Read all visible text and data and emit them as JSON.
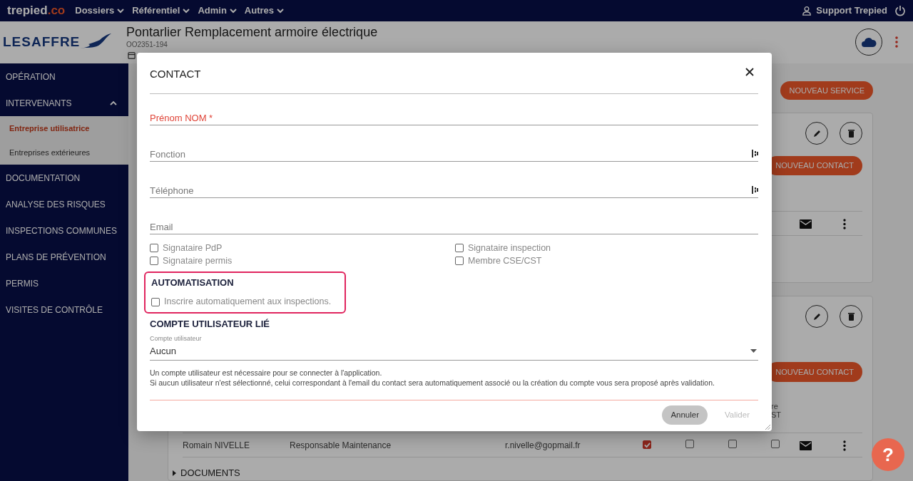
{
  "navbar": {
    "brand": {
      "name": "trepied",
      "suffix": ".co"
    },
    "menus": [
      "Dossiers",
      "Référentiel",
      "Admin",
      "Autres"
    ],
    "user": "Support Trepied"
  },
  "header": {
    "company": "LESAFFRE",
    "title": "Pontarlier Remplacement armoire électrique",
    "code": "OO2351-194"
  },
  "sidebar": {
    "items": [
      {
        "label": "OPÉRATION",
        "kind": "link"
      },
      {
        "label": "INTERVENANTS",
        "kind": "group",
        "expanded": true,
        "children": [
          {
            "label": "Entreprise utilisatrice",
            "selected": true
          },
          {
            "label": "Entreprises extérieures",
            "selected": false
          }
        ]
      },
      {
        "label": "DOCUMENTATION",
        "kind": "link"
      },
      {
        "label": "ANALYSE DES RISQUES",
        "kind": "link"
      },
      {
        "label": "INSPECTIONS COMMUNES",
        "kind": "link"
      },
      {
        "label": "PLANS DE PRÉVENTION",
        "kind": "link"
      },
      {
        "label": "PERMIS",
        "kind": "link"
      },
      {
        "label": "VISITES DE CONTRÔLE",
        "kind": "link"
      }
    ]
  },
  "main": {
    "new_service": "NOUVEAU SERVICE",
    "cards": [
      {
        "new_contact": "NOUVEAU CONTACT",
        "rows": [
          {
            "kind": "partial"
          }
        ]
      },
      {
        "new_contact": "NOUVEAU CONTACT",
        "column_fragment": [
          "re",
          "ST"
        ],
        "rows": [
          {
            "kind": "full",
            "name": "Romain NIVELLE",
            "role": "Responsable Maintenance",
            "email": "r.nivelle@gopmail.fr",
            "flags": [
              {
                "checked": true
              },
              {
                "checked": false
              },
              {
                "checked": false
              },
              {
                "checked": false
              }
            ]
          }
        ],
        "section": "DOCUMENTS"
      }
    ]
  },
  "dialog": {
    "title": "CONTACT",
    "fields": [
      {
        "placeholder": "Prénom NOM *",
        "required": true,
        "addon": false
      },
      {
        "placeholder": "Fonction",
        "required": false,
        "addon": true
      },
      {
        "placeholder": "Téléphone",
        "required": false,
        "addon": true
      },
      {
        "placeholder": "Email",
        "required": false,
        "addon": false
      }
    ],
    "roles": [
      {
        "label": "Signataire PdP",
        "checked": false
      },
      {
        "label": "Signataire inspection",
        "checked": false
      },
      {
        "label": "Signataire permis",
        "checked": false
      },
      {
        "label": "Membre CSE/CST",
        "checked": false
      }
    ],
    "automation": {
      "heading": "AUTOMATISATION",
      "highlighted": true,
      "option": {
        "label": "Inscrire automatiquement aux inspections.",
        "checked": false
      }
    },
    "account": {
      "heading": "COMPTE UTILISATEUR LIÉ",
      "label": "Compte utilisateur",
      "value": "Aucun",
      "help": [
        "Un compte utilisateur est nécessaire pour se connecter à l'application.",
        "Si aucun utilisateur n'est sélectionné, celui correspondant à l'email du contact sera automatiquement associé ou la création du compte vous sera proposé après validation."
      ]
    },
    "buttons": [
      {
        "label": "Annuler",
        "kind": "secondary",
        "disabled": false
      },
      {
        "label": "Valider",
        "kind": "primary",
        "disabled": true
      }
    ]
  },
  "help_button": "?"
}
